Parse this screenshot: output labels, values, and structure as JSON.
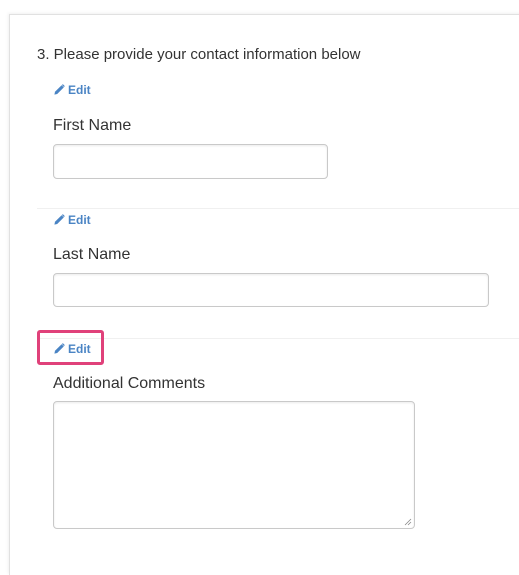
{
  "question": {
    "title": "3. Please provide your contact information below"
  },
  "edit_links": [
    {
      "label": "Edit",
      "icon": "pencil-icon"
    },
    {
      "label": "Edit",
      "icon": "pencil-icon"
    },
    {
      "label": "Edit",
      "icon": "pencil-icon"
    }
  ],
  "fields": {
    "first_name": {
      "label": "First Name",
      "value": ""
    },
    "last_name": {
      "label": "Last Name",
      "value": ""
    },
    "comments": {
      "label": "Additional Comments",
      "value": ""
    }
  },
  "colors": {
    "link": "#4a84c4",
    "highlight": "#e0417a",
    "text": "#333333"
  }
}
